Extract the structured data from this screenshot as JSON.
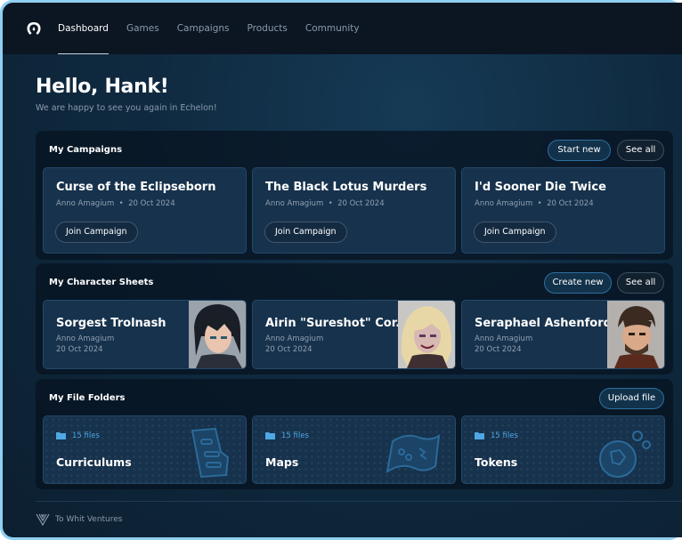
{
  "nav": {
    "items": [
      {
        "label": "Dashboard",
        "active": true
      },
      {
        "label": "Games",
        "active": false
      },
      {
        "label": "Campaigns",
        "active": false
      },
      {
        "label": "Products",
        "active": false
      },
      {
        "label": "Community",
        "active": false
      }
    ]
  },
  "greeting": {
    "title": "Hello, Hank!",
    "subtitle": "We are happy to see you again in Echelon!"
  },
  "campaigns": {
    "title": "My Campaigns",
    "start_label": "Start new",
    "see_all_label": "See all",
    "items": [
      {
        "name": "Curse of the Eclipseborn",
        "author": "Anno Amagium",
        "sep": "•",
        "date": "20 Oct 2024",
        "join_label": "Join Campaign"
      },
      {
        "name": "The Black Lotus Murders",
        "author": "Anno Amagium",
        "sep": "•",
        "date": "20 Oct 2024",
        "join_label": "Join Campaign"
      },
      {
        "name": "I'd Sooner Die Twice",
        "author": "Anno Amagium",
        "sep": "•",
        "date": "20 Oct 2024",
        "join_label": "Join Campaign"
      }
    ]
  },
  "characters": {
    "title": "My Character Sheets",
    "create_label": "Create new",
    "see_all_label": "See all",
    "items": [
      {
        "name": "Sorgest Trolnash",
        "author": "Anno Amagium",
        "date": "20 Oct 2024",
        "portrait": "dark-haired-warrior"
      },
      {
        "name": "Airin \"Sureshot\" Cor...",
        "author": "Anno Amagium",
        "date": "20 Oct 2024",
        "portrait": "blonde-rogue"
      },
      {
        "name": "Seraphael Ashenford",
        "author": "Anno Amagium",
        "date": "20 Oct 2024",
        "portrait": "bearded-noble"
      }
    ]
  },
  "folders": {
    "title": "My File Folders",
    "upload_label": "Upload file",
    "items": [
      {
        "count": "15 files",
        "name": "Curriculums",
        "icon": "document-icon"
      },
      {
        "count": "15 files",
        "name": "Maps",
        "icon": "map-icon"
      },
      {
        "count": "15 files",
        "name": "Tokens",
        "icon": "token-icon"
      }
    ]
  },
  "footer": {
    "brand": "To Whit Ventures"
  },
  "colors": {
    "accent": "#4ea8e6",
    "card_bg": "#17324c",
    "nav_bg": "#0b1622"
  }
}
